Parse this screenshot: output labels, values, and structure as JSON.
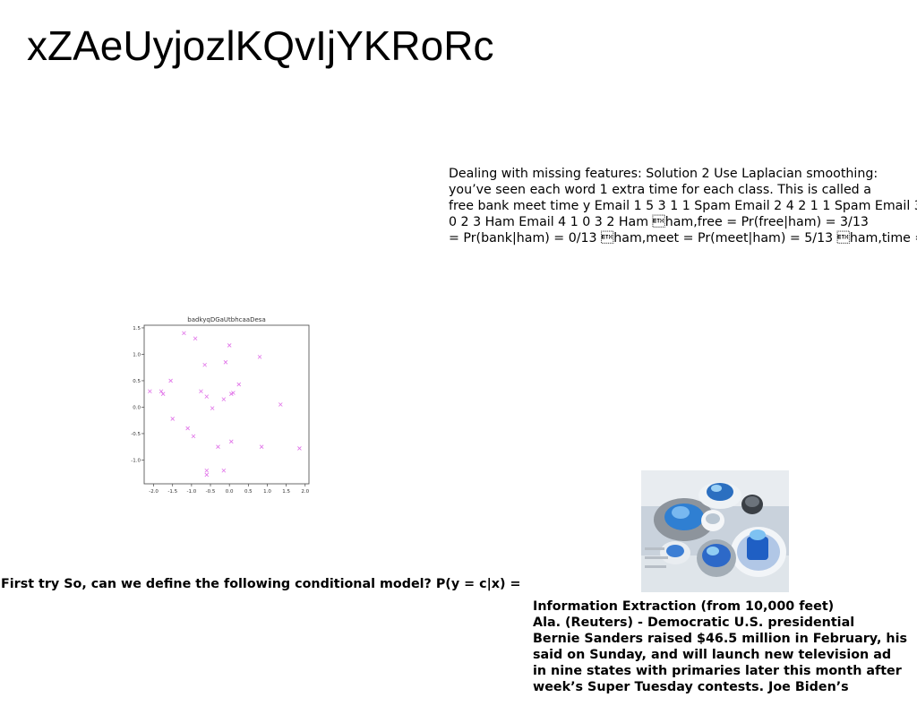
{
  "page": {
    "title": "xZAeUyjozlKQvIjYKRoRc",
    "laplacian_text": [
      "Dealing with missing features: Solution 2 Use Laplacian smoothing:",
      "you’ve seen each word 1 extra time for each class. This is called a",
      "free bank meet time y Email 1 5 3 1 1 Spam Email 2 4 2 1 1 Spam Email 3",
      "0 2 3 Ham Email 4 1 0 3 2 Ham \u0003ham,free = Pr(free|ham) = 3/13",
      "= Pr(bank|ham) = 0/13 \u0003ham,meet = Pr(meet|ham) = 5/13 \u0003ham,time ="
    ],
    "first_try_text": "First try So, can we define the following conditional model? P(y = c|x) =",
    "ie_text": [
      "Information Extraction (from 10,000 feet)",
      "Ala. (Reuters) - Democratic U.S. presidential",
      "Bernie Sanders raised $46.5 million in February, his",
      "said on Sunday, and will launch new television ad",
      "in nine states with primaries later this month after",
      "week’s Super Tuesday contests. Joe Biden’s"
    ]
  },
  "chart_data": {
    "type": "scatter",
    "title": "badkyqDGaUtbhcaaDesa",
    "xlabel": "",
    "ylabel": "",
    "xlim": [
      -2.25,
      2.1
    ],
    "ylim": [
      -1.45,
      1.55
    ],
    "xticks": [
      "-2.0",
      "-1.5",
      "-1.0",
      "-0.5",
      "0.0",
      "0.5",
      "1.0",
      "1.5",
      "2.0"
    ],
    "xtick_values": [
      -2.0,
      -1.5,
      -1.0,
      -0.5,
      0.0,
      0.5,
      1.0,
      1.5,
      2.0
    ],
    "yticks": [
      "1.5",
      "1.0",
      "0.5",
      "0.0",
      "-0.5",
      "-1.0"
    ],
    "ytick_values": [
      1.5,
      1.0,
      0.5,
      0.0,
      -0.5,
      -1.0
    ],
    "grid": false,
    "marker": "x",
    "color": "#e070e8",
    "x": [
      -2.1,
      -1.8,
      -1.75,
      -1.55,
      -1.5,
      -1.2,
      -1.1,
      -0.95,
      -0.9,
      -0.75,
      -0.65,
      -0.6,
      -0.6,
      -0.6,
      -0.45,
      -0.3,
      -0.15,
      -0.15,
      -0.1,
      0.0,
      0.05,
      0.05,
      0.1,
      0.25,
      0.8,
      0.85,
      1.35,
      1.85
    ],
    "y": [
      0.3,
      0.3,
      0.25,
      0.5,
      -0.22,
      1.4,
      -0.4,
      -0.55,
      1.3,
      0.3,
      0.8,
      0.2,
      -1.2,
      -1.28,
      -0.02,
      -0.75,
      0.15,
      -1.2,
      0.85,
      1.17,
      -0.65,
      0.25,
      0.27,
      0.43,
      0.95,
      -0.75,
      0.05,
      -0.78
    ]
  }
}
